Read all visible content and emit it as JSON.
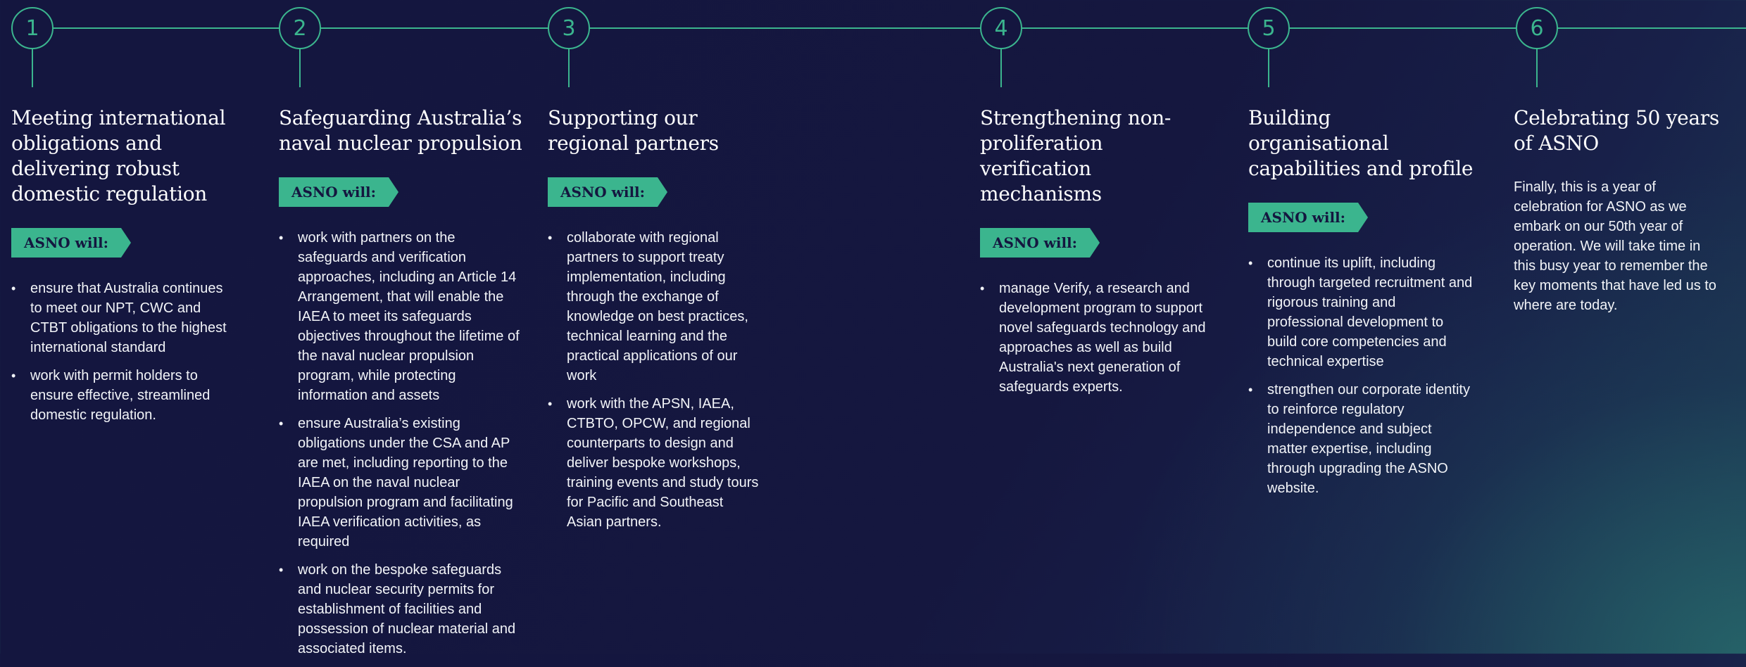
{
  "sections": [
    {
      "number": "1",
      "title": "Meeting international obligations and delivering robust domestic regulation",
      "tag": "ASNO will:",
      "items": [
        "ensure that Australia continues to meet our NPT, CWC and CTBT obligations to the highest international standard",
        "work with permit holders to ensure effective, streamlined domestic regulation."
      ]
    },
    {
      "number": "2",
      "title": "Safeguarding Australia’s naval nuclear propulsion",
      "tag": "ASNO will:",
      "items": [
        "work with partners on the safeguards and verification approaches, including an Article 14 Arrangement, that will enable the IAEA to meet its safeguards objectives throughout the lifetime of the naval nuclear propulsion program, while protecting information and assets",
        "ensure Australia’s existing obligations under the CSA and AP are met, including reporting to the IAEA on the naval nuclear propulsion program and facilitating IAEA verification activities, as required",
        "work on the bespoke safeguards and nuclear security permits for establishment of facilities and possession of nuclear material and associated items."
      ]
    },
    {
      "number": "3",
      "title": "Supporting our regional partners",
      "tag": "ASNO will:",
      "items": [
        "collaborate with regional partners to support treaty implementation, including through the exchange of knowledge on best practices, technical learning and the practical applications of our work",
        "work with the APSN, IAEA, CTBTO, OPCW, and regional counterparts to design and deliver bespoke workshops, training events and study tours for Pacific and Southeast Asian partners."
      ]
    },
    {
      "number": "4",
      "title": "Strengthening non-proliferation verification mechanisms",
      "tag": "ASNO will:",
      "items": [
        "manage Verify, a research and development program to support novel safeguards technology and approaches as well as build Australia's next generation of safeguards experts."
      ]
    },
    {
      "number": "5",
      "title": "Building organisational capabilities and profile",
      "tag": "ASNO will:",
      "items": [
        "continue its uplift, including through targeted recruitment and rigorous training and professional development to build core competencies and technical expertise",
        "strengthen our corporate identity to reinforce regulatory independence and subject matter expertise, including through upgrading the ASNO website."
      ]
    },
    {
      "number": "6",
      "title": "Celebrating 50 years of ASNO",
      "text": "Finally, this is a year of celebration for ASNO as we embark on our 50th year of operation. We will take time in this busy year to remember the key moments that have led us to where are today."
    }
  ]
}
